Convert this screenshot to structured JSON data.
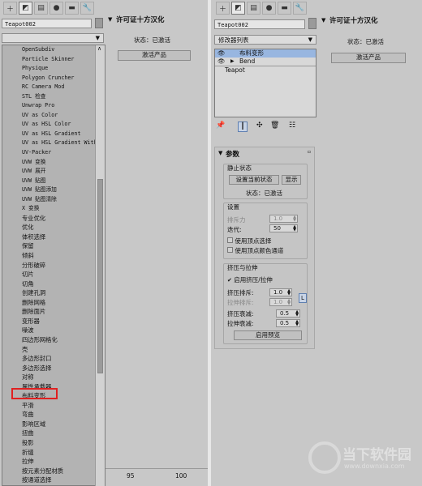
{
  "left_panel": {
    "object_name": "Teapot002",
    "modifier_list": [
      "OpenSubdiv",
      "Particle Skinner",
      "Physique",
      "Polygon Cruncher",
      "RC Camera Mod",
      "STL 检查",
      "Unwrap Pro",
      "UV as Color",
      "UV as HSL Color",
      "UV as HSL Gradient",
      "UV as HSL Gradient With",
      "UV-Packer",
      "UVW 变换",
      "UVW 展开",
      "UVW 贴图",
      "UVW 贴图添加",
      "UVW 贴图清除",
      "X 变换",
      "专业优化",
      "优化",
      "体积选择",
      "保留",
      "倾斜",
      "分形破碎",
      "切片",
      "切角",
      "创建孔洞",
      "删除网格",
      "删除面片",
      "变形器",
      "噪波",
      "四边形网格化",
      "壳",
      "多边形封口",
      "多边形选择",
      "对称",
      "属性承载器",
      "布料变形",
      "平滑",
      "弯曲",
      "影响区域",
      "扭曲",
      "投影",
      "折缝",
      "拉伸",
      "按元素分配材质",
      "按通道选择",
      "挤压"
    ],
    "highlighted_item": "布料变形",
    "ruler": {
      "t95": "95",
      "t100": "100"
    }
  },
  "license_panel": {
    "title": "许可证十方汉化",
    "status": "状态：已激活",
    "activate_button": "激活产品"
  },
  "right_panel": {
    "object_name": "Teapot002",
    "modifier_list_label": "修改器列表",
    "stack": {
      "item1": "布料变形",
      "item2": "Bend",
      "item3": "Teapot"
    },
    "params": {
      "title": "参数",
      "rest_state": "静止状态",
      "set_current": "设置当前状态",
      "show": "显示",
      "status": "状态：已激活",
      "settings": "设置",
      "smooth_label": "排斥力",
      "smooth_value": "1.0",
      "iter_label": "迭代:",
      "iter_value": "50",
      "use_vertex_select": "使用顶点选择",
      "use_vertex_color": "使用顶点颜色通道",
      "squash_stretch": "挤压与拉伸",
      "enable_squash": "启用挤压/拉伸",
      "squash_repel_label": "挤压排斥:",
      "squash_repel_value": "1.0",
      "stretch_repel_label": "拉伸排斥:",
      "stretch_repel_value": "1.0",
      "lock_label": "L",
      "squash_decay_label": "挤压衰减:",
      "squash_decay_value": "0.5",
      "stretch_decay_label": "拉伸衰减:",
      "stretch_decay_value": "0.5",
      "enable_preview": "启用预览"
    }
  },
  "watermark": {
    "brand": "当下软件园",
    "url": "www.downxia.com"
  }
}
